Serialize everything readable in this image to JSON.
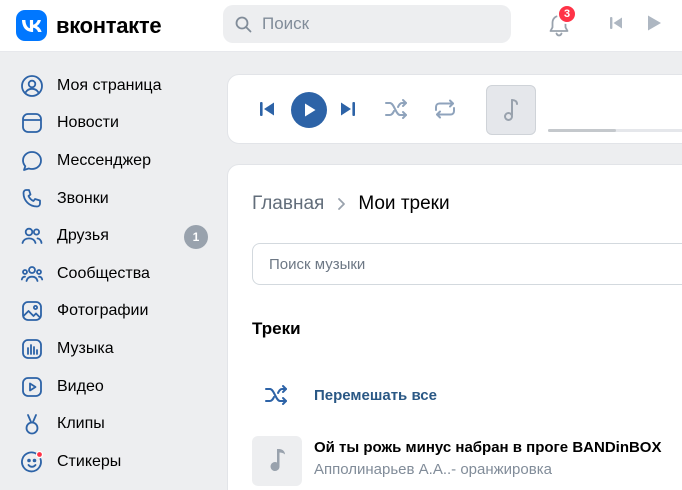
{
  "header": {
    "logo_text": "вконтакте",
    "search_placeholder": "Поиск",
    "notifications_count": "3"
  },
  "sidebar": {
    "items": [
      {
        "label": "Моя страница",
        "icon": "user-circle-icon"
      },
      {
        "label": "Новости",
        "icon": "news-icon"
      },
      {
        "label": "Мессенджер",
        "icon": "message-icon"
      },
      {
        "label": "Звонки",
        "icon": "phone-icon"
      },
      {
        "label": "Друзья",
        "icon": "friends-icon",
        "count": "1"
      },
      {
        "label": "Сообщества",
        "icon": "communities-icon"
      },
      {
        "label": "Фотографии",
        "icon": "photo-icon"
      },
      {
        "label": "Музыка",
        "icon": "music-icon"
      },
      {
        "label": "Видео",
        "icon": "video-icon"
      },
      {
        "label": "Клипы",
        "icon": "clips-icon"
      },
      {
        "label": "Стикеры",
        "icon": "stickers-icon"
      }
    ]
  },
  "player": {
    "progress": 0.45
  },
  "main": {
    "breadcrumb_home": "Главная",
    "breadcrumb_current": "Мои треки",
    "search_placeholder": "Поиск музыки",
    "section_title": "Треки",
    "shuffle_all_label": "Перемешать все",
    "tracks": [
      {
        "title": "Ой ты рожь минус набран в проге BANDinBOX",
        "artist": "Апполинарьев А.А..- оранжировка"
      }
    ]
  },
  "colors": {
    "brand": "#0077ff",
    "accent": "#2d63a7",
    "link": "#2a5885",
    "badge": "#ff3347",
    "background": "#edeef0"
  }
}
